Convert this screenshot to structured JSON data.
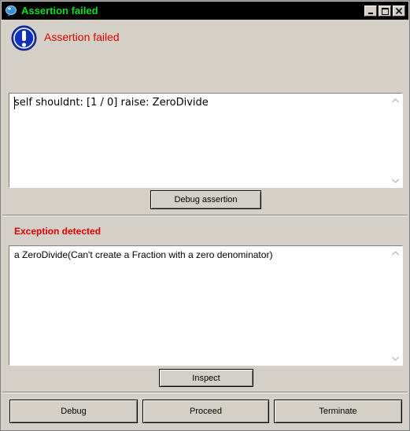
{
  "window": {
    "title": "Assertion failed"
  },
  "colors": {
    "title_text": "#00e020",
    "error_text": "#e00000",
    "face": "#d4d0c8"
  },
  "icons": {
    "app": "squeak-balloon-icon",
    "warning": "exclamation-icon"
  },
  "header": {
    "message": "Assertion failed"
  },
  "assertion": {
    "code": "self shouldnt: [1 / 0] raise: ZeroDivide",
    "debug_button": "Debug assertion"
  },
  "exception": {
    "label": "Exception detected",
    "text": "a ZeroDivide(Can't create a Fraction with a zero denominator)",
    "inspect_button": "Inspect"
  },
  "actions": {
    "debug": "Debug",
    "proceed": "Proceed",
    "terminate": "Terminate"
  }
}
